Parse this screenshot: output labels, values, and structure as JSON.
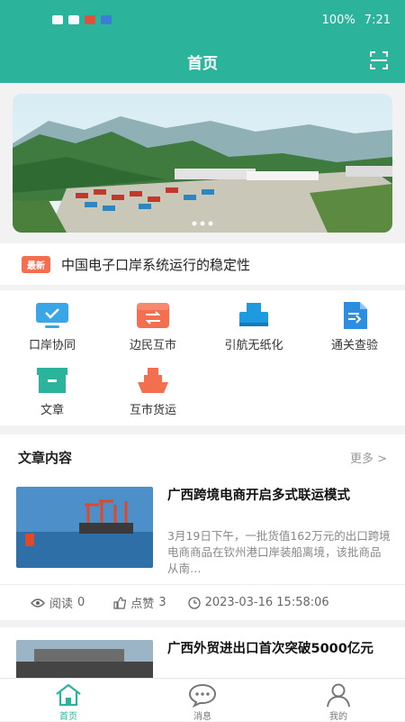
{
  "status": {
    "battery": "100%",
    "time": "7:21"
  },
  "header": {
    "title": "首页"
  },
  "notice": {
    "tag": "最新",
    "text": "中国电子口岸系统运行的稳定性"
  },
  "grid": [
    {
      "label": "口岸协同",
      "icon": "monitor-icon",
      "color": "#3aa6e8"
    },
    {
      "label": "边民互市",
      "icon": "market-icon",
      "color": "#f36f50"
    },
    {
      "label": "引航无纸化",
      "icon": "printer-icon",
      "color": "#1e9be0"
    },
    {
      "label": "通关查验",
      "icon": "document-icon",
      "color": "#2d8ee0"
    },
    {
      "label": "文章",
      "icon": "archive-icon",
      "color": "#2bb39b"
    },
    {
      "label": "互市货运",
      "icon": "ship-icon",
      "color": "#f36f50"
    }
  ],
  "articles_section": {
    "title": "文章内容",
    "more": "更多 >"
  },
  "articles": [
    {
      "title": "广西跨境电商开启多式联运模式",
      "desc": "3月19日下午，一批货值162万元的出口跨境电商商品在钦州港口岸装船离境，该批商品从南…",
      "reads_label": "阅读",
      "reads": "0",
      "likes_label": "点赞",
      "likes": "3",
      "time": "2023-03-16 15:58:06"
    },
    {
      "title": "广西外贸进出口首次突破5000亿元"
    }
  ],
  "tabs": [
    {
      "label": "首页",
      "icon": "home-icon"
    },
    {
      "label": "消息",
      "icon": "message-icon"
    },
    {
      "label": "我的",
      "icon": "user-icon"
    }
  ]
}
